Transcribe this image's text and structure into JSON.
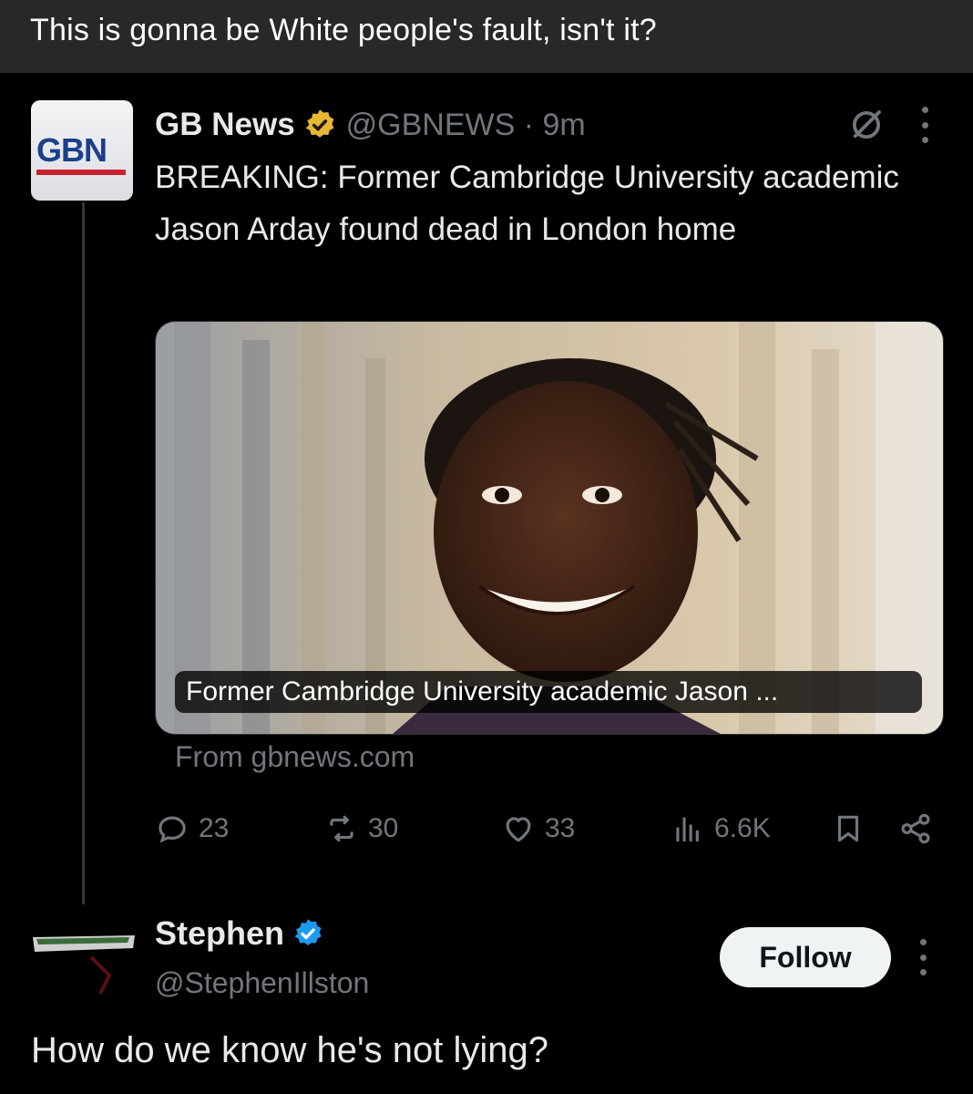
{
  "caption": "This is gonna be White people's fault, isn't it?",
  "tweet": {
    "avatar_logo_text": "GBN",
    "display_name": "GB News",
    "handle_time": "@GBNEWS · 9m",
    "text": "BREAKING: Former Cambridge University academic Jason Arday found dead in London home",
    "media_caption": "Former Cambridge University academic Jason ...",
    "source": "From gbnews.com",
    "stats": {
      "replies": "23",
      "reposts": "30",
      "likes": "33",
      "views": "6.6K"
    }
  },
  "reply": {
    "display_name": "Stephen",
    "handle": "@StephenIllston",
    "follow_label": "Follow",
    "text": "How do we know he's not lying?"
  },
  "colors": {
    "background": "#000000",
    "caption_bar": "#282828",
    "text_primary": "#e7e9ea",
    "text_secondary": "#71767b",
    "verified_gold": "#e8b830",
    "verified_blue": "#1d9bf0"
  },
  "icons": [
    "grok-icon",
    "more-icon",
    "verified-gold-icon",
    "reply-icon",
    "repost-icon",
    "like-icon",
    "views-icon",
    "bookmark-icon",
    "share-icon",
    "verified-blue-icon"
  ]
}
